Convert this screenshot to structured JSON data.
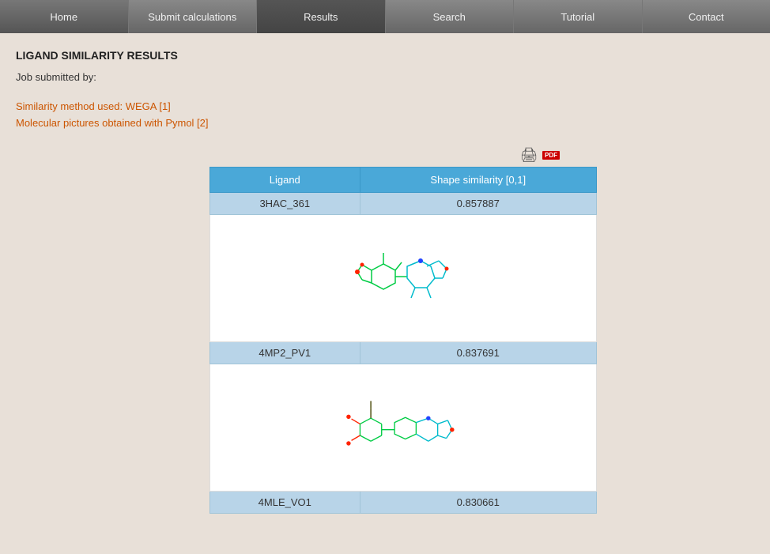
{
  "nav": {
    "items": [
      {
        "label": "Home",
        "active": false
      },
      {
        "label": "Submit calculations",
        "active": false
      },
      {
        "label": "Results",
        "active": true
      },
      {
        "label": "Search",
        "active": false
      },
      {
        "label": "Tutorial",
        "active": false
      },
      {
        "label": "Contact",
        "active": false
      }
    ]
  },
  "page": {
    "title": "LIGAND SIMILARITY RESULTS",
    "job_submitted_label": "Job submitted by:",
    "similarity_method": "Similarity method used: WEGA [1]",
    "molecular_pictures": "Molecular pictures obtained with Pymol [2]"
  },
  "table": {
    "col1_header": "Ligand",
    "col2_header": "Shape similarity [0,1]",
    "rows": [
      {
        "ligand": "3HAC_361",
        "similarity": "0.857887"
      },
      {
        "ligand": "4MP2_PV1",
        "similarity": "0.837691"
      },
      {
        "ligand": "4MLE_VO1",
        "similarity": "0.830661"
      }
    ]
  },
  "icons": {
    "print_label": "Print",
    "pdf_label": "PDF"
  }
}
